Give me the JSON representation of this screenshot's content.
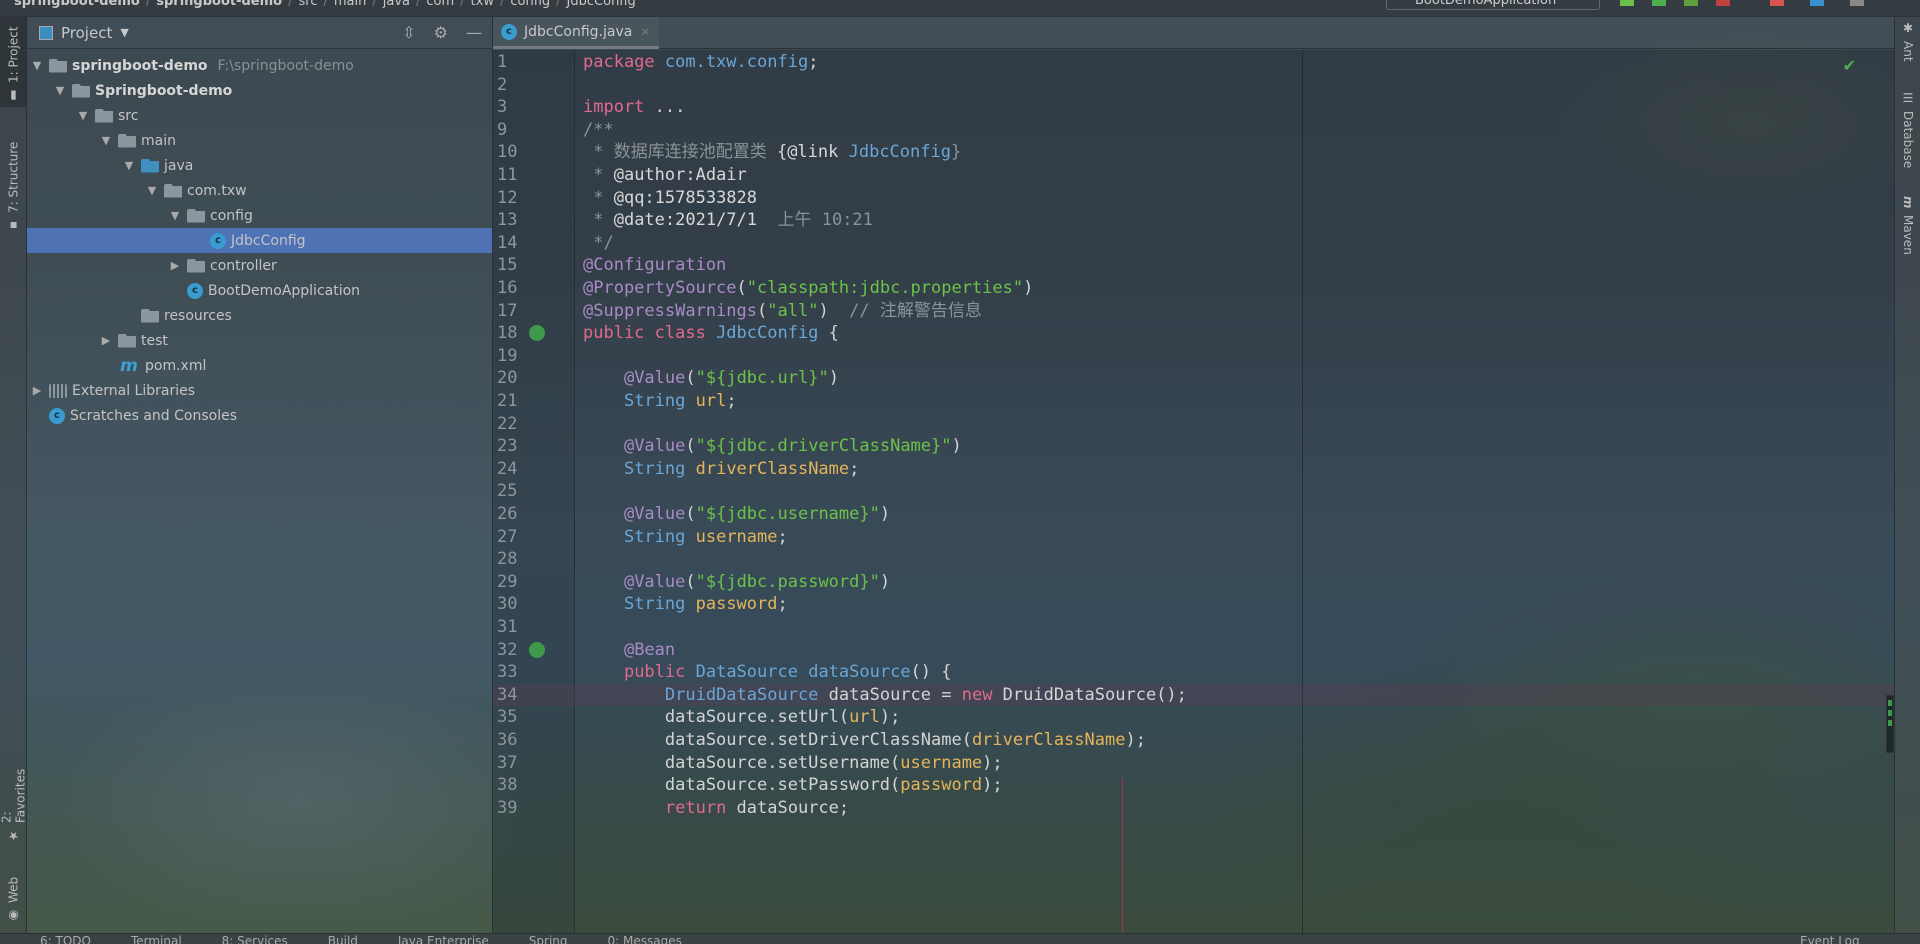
{
  "breadcrumbs": [
    "springboot-demo",
    "springboot-demo",
    "src",
    "main",
    "java",
    "com",
    "txw",
    "config",
    "JdbcConfig"
  ],
  "run_config": "BootDemoApplication",
  "left_tabs": [
    {
      "label": "1: Project"
    },
    {
      "label": "7: Structure"
    },
    {
      "label": "2: Favorites"
    },
    {
      "label": "Web"
    }
  ],
  "right_tabs": [
    {
      "label": "Ant"
    },
    {
      "label": "Database"
    },
    {
      "label": "Maven"
    }
  ],
  "project_panel": {
    "title": "Project",
    "tree": [
      {
        "label": "springboot-demo",
        "hint": "F:\\springboot-demo",
        "bold": true,
        "level": 0,
        "arrow": "down",
        "icon": "module"
      },
      {
        "label": "Springboot-demo",
        "bold": true,
        "level": 1,
        "arrow": "down",
        "icon": "module"
      },
      {
        "label": "src",
        "level": 2,
        "arrow": "down",
        "icon": "folder"
      },
      {
        "label": "main",
        "level": 3,
        "arrow": "down",
        "icon": "folder"
      },
      {
        "label": "java",
        "level": 4,
        "arrow": "down",
        "icon": "source-folder"
      },
      {
        "label": "com.txw",
        "level": 5,
        "arrow": "down",
        "icon": "package"
      },
      {
        "label": "config",
        "level": 6,
        "arrow": "down",
        "icon": "package"
      },
      {
        "label": "JdbcConfig",
        "level": 7,
        "arrow": "",
        "icon": "class",
        "selected": true
      },
      {
        "label": "controller",
        "level": 6,
        "arrow": "right",
        "icon": "package"
      },
      {
        "label": "BootDemoApplication",
        "level": 6,
        "arrow": "",
        "icon": "spring-class"
      },
      {
        "label": "resources",
        "level": 4,
        "arrow": "",
        "icon": "resources-folder"
      },
      {
        "label": "test",
        "level": 3,
        "arrow": "right",
        "icon": "folder"
      },
      {
        "label": "pom.xml",
        "level": 3,
        "arrow": "",
        "icon": "maven"
      },
      {
        "label": "External Libraries",
        "level": 0,
        "arrow": "right",
        "icon": "libraries"
      },
      {
        "label": "Scratches and Consoles",
        "level": 0,
        "arrow": "",
        "icon": "scratches"
      }
    ]
  },
  "editor": {
    "tab": "JdbcConfig.java",
    "current_line": "34",
    "lines": [
      {
        "n": "1",
        "t": [
          [
            "k",
            "package "
          ],
          [
            "pk",
            "com.txw.config"
          ],
          [
            "",
            "; "
          ]
        ]
      },
      {
        "n": "2",
        "t": []
      },
      {
        "n": "3",
        "t": [
          [
            "k",
            "import "
          ],
          [
            "",
            "..."
          ]
        ]
      },
      {
        "n": "9",
        "t": [
          [
            "c",
            "/**"
          ]
        ]
      },
      {
        "n": "10",
        "t": [
          [
            "c",
            " * 数据库连接池配置类 "
          ],
          [
            "cb",
            "{@link "
          ],
          [
            "t",
            "JdbcConfig"
          ],
          [
            "c",
            "}"
          ]
        ]
      },
      {
        "n": "11",
        "t": [
          [
            "c",
            " * "
          ],
          [
            "cb",
            "@author:Adair"
          ]
        ]
      },
      {
        "n": "12",
        "t": [
          [
            "c",
            " * "
          ],
          [
            "cb",
            "@qq:1578533828"
          ]
        ]
      },
      {
        "n": "13",
        "t": [
          [
            "c",
            " * "
          ],
          [
            "cb",
            "@date:2021/7/1"
          ],
          [
            "c",
            "  上午 10:21"
          ]
        ]
      },
      {
        "n": "14",
        "t": [
          [
            "c",
            " */"
          ]
        ]
      },
      {
        "n": "15",
        "t": [
          [
            "an",
            "@Configuration"
          ]
        ]
      },
      {
        "n": "16",
        "t": [
          [
            "an",
            "@PropertySource"
          ],
          [
            "",
            "("
          ],
          [
            "s",
            "\"classpath:jdbc.properties\""
          ],
          [
            "",
            ")"
          ]
        ]
      },
      {
        "n": "17",
        "t": [
          [
            "an",
            "@SuppressWarnings"
          ],
          [
            "",
            "("
          ],
          [
            "s",
            "\"all\""
          ],
          [
            "",
            ")  "
          ],
          [
            "c",
            "// 注解警告信息"
          ]
        ]
      },
      {
        "n": "18",
        "t": [
          [
            "k",
            "public class "
          ],
          [
            "t",
            "JdbcConfig "
          ],
          [
            "",
            "{"
          ]
        ],
        "gutter": "spring-bean-icon"
      },
      {
        "n": "19",
        "t": []
      },
      {
        "n": "20",
        "t": [
          [
            "",
            "    "
          ],
          [
            "an",
            "@Value"
          ],
          [
            "",
            "("
          ],
          [
            "s",
            "\"${jdbc.url}\""
          ],
          [
            "",
            ")"
          ]
        ]
      },
      {
        "n": "21",
        "t": [
          [
            "",
            "    "
          ],
          [
            "t",
            "String "
          ],
          [
            "f",
            "url"
          ],
          [
            "",
            ";"
          ]
        ]
      },
      {
        "n": "22",
        "t": []
      },
      {
        "n": "23",
        "t": [
          [
            "",
            "    "
          ],
          [
            "an",
            "@Value"
          ],
          [
            "",
            "("
          ],
          [
            "s",
            "\"${jdbc.driverClassName}\""
          ],
          [
            "",
            ")"
          ]
        ]
      },
      {
        "n": "24",
        "t": [
          [
            "",
            "    "
          ],
          [
            "t",
            "String "
          ],
          [
            "f",
            "driverClassName"
          ],
          [
            "",
            ";"
          ]
        ]
      },
      {
        "n": "25",
        "t": []
      },
      {
        "n": "26",
        "t": [
          [
            "",
            "    "
          ],
          [
            "an",
            "@Value"
          ],
          [
            "",
            "("
          ],
          [
            "s",
            "\"${jdbc.username}\""
          ],
          [
            "",
            ")"
          ]
        ]
      },
      {
        "n": "27",
        "t": [
          [
            "",
            "    "
          ],
          [
            "t",
            "String "
          ],
          [
            "f",
            "username"
          ],
          [
            "",
            ";"
          ]
        ]
      },
      {
        "n": "28",
        "t": []
      },
      {
        "n": "29",
        "t": [
          [
            "",
            "    "
          ],
          [
            "an",
            "@Value"
          ],
          [
            "",
            "("
          ],
          [
            "s",
            "\"${jdbc.password}\""
          ],
          [
            "",
            ")"
          ]
        ]
      },
      {
        "n": "30",
        "t": [
          [
            "",
            "    "
          ],
          [
            "t",
            "String "
          ],
          [
            "f",
            "password"
          ],
          [
            "",
            ";"
          ]
        ]
      },
      {
        "n": "31",
        "t": []
      },
      {
        "n": "32",
        "t": [
          [
            "",
            "    "
          ],
          [
            "an",
            "@Bean"
          ]
        ],
        "gutter": "spring-bean-icon"
      },
      {
        "n": "33",
        "t": [
          [
            "",
            "    "
          ],
          [
            "k",
            "public "
          ],
          [
            "t",
            "DataSource "
          ],
          [
            "m",
            "dataSource"
          ],
          [
            "",
            "() {"
          ]
        ]
      },
      {
        "n": "34",
        "t": [
          [
            "",
            "        "
          ],
          [
            "t",
            "DruidDataSource "
          ],
          [
            "",
            "dataSource = "
          ],
          [
            "k",
            "new "
          ],
          [
            "",
            "DruidDataSource();"
          ]
        ]
      },
      {
        "n": "35",
        "t": [
          [
            "",
            "        dataSource.setUrl("
          ],
          [
            "f",
            "url"
          ],
          [
            "",
            ");"
          ]
        ]
      },
      {
        "n": "36",
        "t": [
          [
            "",
            "        dataSource.setDriverClassName("
          ],
          [
            "f",
            "driverClassName"
          ],
          [
            "",
            ");"
          ]
        ]
      },
      {
        "n": "37",
        "t": [
          [
            "",
            "        dataSource.setUsername("
          ],
          [
            "f",
            "username"
          ],
          [
            "",
            ");"
          ]
        ]
      },
      {
        "n": "38",
        "t": [
          [
            "",
            "        dataSource.setPassword("
          ],
          [
            "f",
            "password"
          ],
          [
            "",
            ");"
          ]
        ]
      },
      {
        "n": "39",
        "t": [
          [
            "",
            "        "
          ],
          [
            "k",
            "return "
          ],
          [
            "",
            "dataSource;"
          ]
        ]
      }
    ]
  },
  "status_bar": [
    "6: TODO",
    "Terminal",
    "8: Services",
    "Build",
    "Java Enterprise",
    "Spring",
    "0: Messages",
    "Event Log"
  ],
  "colors": {
    "keyword": "#e06a8e",
    "annotation": "#a98bc6",
    "string": "#6cc24a",
    "field": "#e5b45a",
    "type": "#6aa6d6",
    "selection": "#4f72b5"
  }
}
